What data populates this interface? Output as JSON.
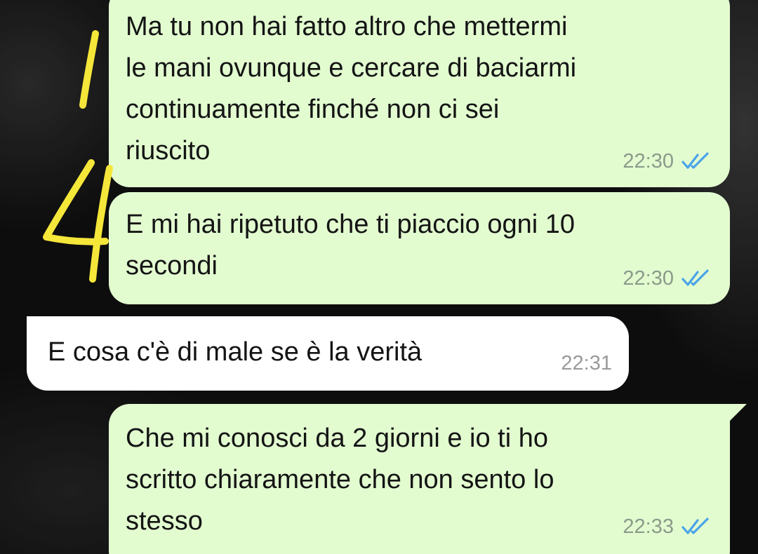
{
  "messages": [
    {
      "direction": "outgoing",
      "text": "Ma tu non hai fatto altro che mettermi\nle mani ovunque e cercare di baciarmi\ncontinuamente finché non ci sei\nriuscito",
      "time": "22:30",
      "status_icon": "double-check-read-icon"
    },
    {
      "direction": "outgoing",
      "text": "E mi hai ripetuto che ti piaccio ogni 10\nsecondi",
      "time": "22:30",
      "status_icon": "double-check-read-icon"
    },
    {
      "direction": "incoming",
      "text": "E cosa c'è di male se è la verità",
      "time": "22:31"
    },
    {
      "direction": "outgoing",
      "text": "Che mi conosci da 2 giorni e io ti ho\nscritto chiaramente che non sento lo\nstesso",
      "time": "22:33",
      "status_icon": "double-check-read-icon"
    }
  ],
  "annotations": {
    "marks": [
      "1",
      "4"
    ],
    "color": "#f5e63a"
  },
  "colors": {
    "outgoing_bubble": "#e2fcd0",
    "incoming_bubble": "#ffffff",
    "read_ticks": "#4aa3e8",
    "background": "#0d0d0d"
  }
}
